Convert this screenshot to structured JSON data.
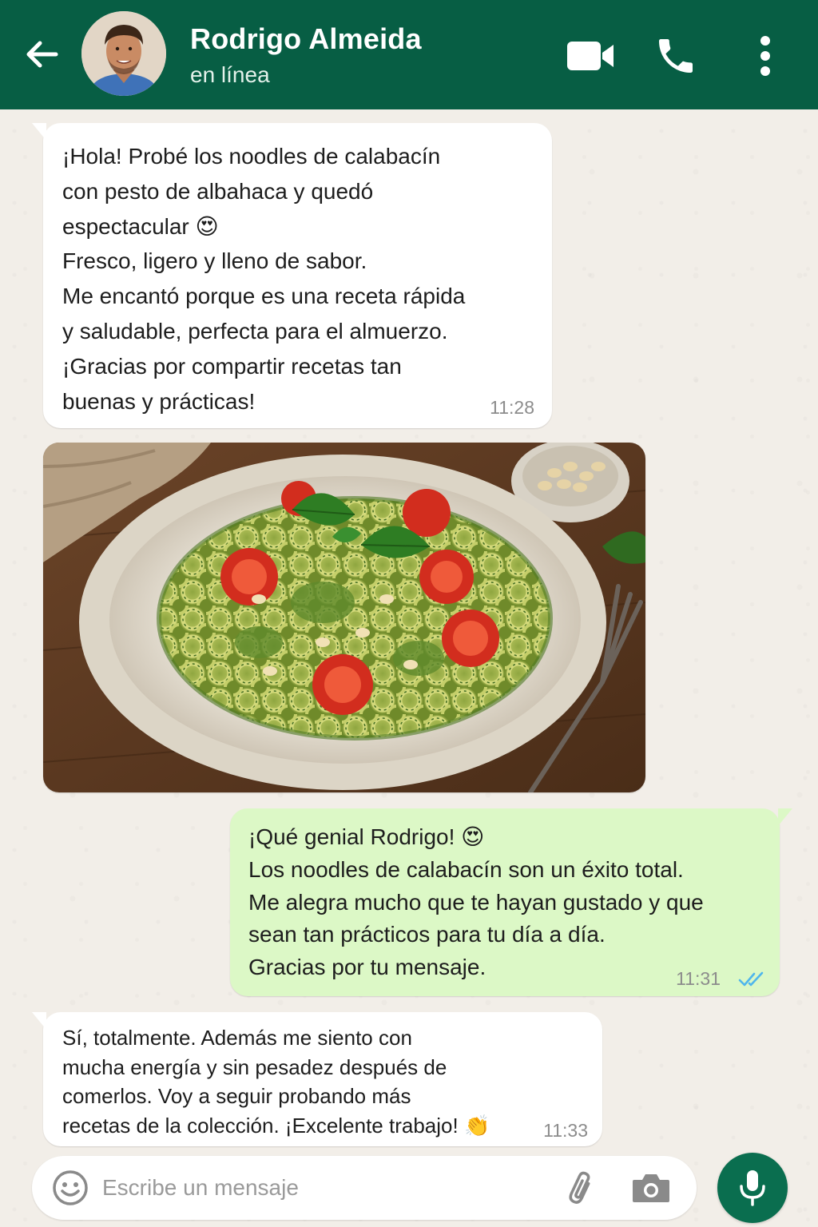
{
  "header": {
    "contact_name": "Rodrigo Almeida",
    "status": "en línea",
    "icons": [
      "back-arrow-icon",
      "video-call-icon",
      "phone-icon",
      "more-vert-icon"
    ]
  },
  "messages": [
    {
      "direction": "incoming",
      "text": "¡Hola! Probé los noodles de calabacín\ncon pesto de albahaca y quedó\nespectacular 😍\nFresco, ligero y lleno de sabor.\nMe encantó porque es una receta rápida\ny saludable, perfecta para el almuerzo.\n¡Gracias por compartir recetas tan\nbuenas y prácticas!",
      "time": "11:28"
    },
    {
      "direction": "incoming",
      "type": "image"
    },
    {
      "direction": "outgoing",
      "text": "¡Qué genial Rodrigo! 😍\nLos noodles de calabacín son un éxito total.\nMe alegra mucho que te hayan gustado y que\nsean tan prácticos para tu día a día.\nGracias por tu mensaje.",
      "time": "11:31",
      "status": "read"
    },
    {
      "direction": "incoming",
      "text": "Sí, totalmente. Además me siento con\nmucha energía y sin pesadez después de\ncomerlos. Voy a seguir probando más\nrecetas de la colección. ¡Excelente trabajo! 👏",
      "time": "11:33"
    }
  ],
  "composer": {
    "placeholder": "Escribe un mensaje",
    "icons": [
      "emoji-icon",
      "attach-icon",
      "camera-icon",
      "mic-icon"
    ]
  },
  "colors": {
    "header": "#075e44",
    "outgoing_bubble": "#dcf8c6",
    "incoming_bubble": "#ffffff",
    "read_ticks": "#4fb6ec",
    "mic_button": "#0a6e4f"
  }
}
